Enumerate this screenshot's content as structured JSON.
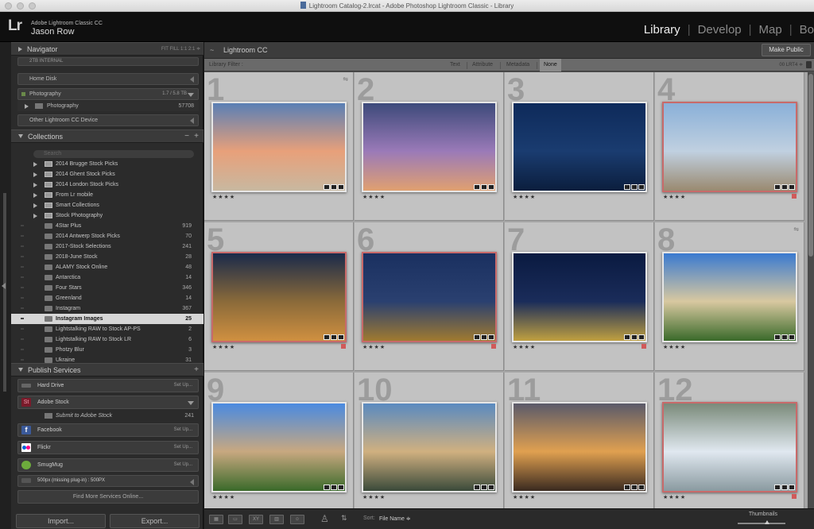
{
  "window": {
    "title": "Lightroom Catalog-2.lrcat - Adobe Photoshop Lightroom Classic - Library"
  },
  "identity": {
    "logo": "Lr",
    "product": "Adobe Lightroom Classic CC",
    "user": "Jason Row"
  },
  "modules": [
    "Library",
    "Develop",
    "Map",
    "Bo"
  ],
  "navigator": {
    "title": "Navigator",
    "modes": "FIT  FILL  1:1  2:1 ≑"
  },
  "volumes": {
    "internal": "2TB INTERNAL",
    "home": "Home Disk",
    "photography": {
      "label": "Photography",
      "capacity": "1.7 / 5.8 TB"
    },
    "photography_folder": {
      "label": "Photography",
      "count": "57708"
    },
    "other_device": "Other Lightroom CC Device"
  },
  "collections": {
    "title": "Collections",
    "search_placeholder": "Search",
    "items": [
      {
        "label": "2014 Brugge Stock Picks",
        "count": "",
        "type": "set"
      },
      {
        "label": "2014 Ghent Stock Picks",
        "count": "",
        "type": "set"
      },
      {
        "label": "2014 London Stock Picks",
        "count": "",
        "type": "set"
      },
      {
        "label": "From Lr mobile",
        "count": "",
        "type": "set"
      },
      {
        "label": "Smart Collections",
        "count": "",
        "type": "set"
      },
      {
        "label": "Stock Photography",
        "count": "",
        "type": "set"
      },
      {
        "label": "4Star Plus",
        "count": "919",
        "type": "coll"
      },
      {
        "label": "2014 Antwerp Stock Picks",
        "count": "70",
        "type": "coll"
      },
      {
        "label": "2017-Stock Selections",
        "count": "241",
        "type": "coll"
      },
      {
        "label": "2018-June Stock",
        "count": "28",
        "type": "coll"
      },
      {
        "label": "ALAMY Stock Online",
        "count": "48",
        "type": "coll"
      },
      {
        "label": "Antarctica",
        "count": "14",
        "type": "coll"
      },
      {
        "label": "Four Stars",
        "count": "346",
        "type": "coll"
      },
      {
        "label": "Greenland",
        "count": "14",
        "type": "coll"
      },
      {
        "label": "Instagram",
        "count": "367",
        "type": "coll"
      },
      {
        "label": "Instagram Images",
        "count": "25",
        "type": "coll",
        "selected": true
      },
      {
        "label": "Lightstalking RAW to Stock AP-PS",
        "count": "2",
        "type": "coll"
      },
      {
        "label": "Lightstalking RAW to Stock LR",
        "count": "6",
        "type": "coll"
      },
      {
        "label": "Photzy Blur",
        "count": "3",
        "type": "coll"
      },
      {
        "label": "Ukraine",
        "count": "31",
        "type": "coll"
      }
    ]
  },
  "publish": {
    "title": "Publish Services",
    "harddrive": {
      "label": "Hard Drive",
      "action": "Set Up..."
    },
    "adobestock": {
      "label": "Adobe Stock",
      "sub": "Submit to Adobe Stock",
      "count": "241"
    },
    "facebook": {
      "label": "Facebook",
      "action": "Set Up..."
    },
    "flickr": {
      "label": "Flickr",
      "action": "Set Up..."
    },
    "smugmug": {
      "label": "SmugMug",
      "action": "Set Up..."
    },
    "fivehundred": {
      "label": "500px (missing plug-in) : 500PX"
    },
    "findmore": "Find More Services Online..."
  },
  "buttons": {
    "import": "Import...",
    "export": "Export..."
  },
  "center": {
    "source": "Lightroom CC",
    "make_public": "Make Public",
    "filter_label": "Library Filter :",
    "filters": [
      "Text",
      "Attribute",
      "Metadata",
      "None"
    ],
    "preset": "00 LRT4 ≑"
  },
  "photos": [
    {
      "num": "1",
      "stars": "★★★★",
      "red": false,
      "label": false,
      "sky": [
        "#5a7fb5",
        "#e8a07a",
        "#c8b8a0"
      ]
    },
    {
      "num": "2",
      "stars": "★★★★",
      "red": false,
      "label": false,
      "sky": [
        "#3d4a7a",
        "#9a7ab8",
        "#e0a070"
      ]
    },
    {
      "num": "3",
      "stars": "★★★★",
      "red": false,
      "label": false,
      "sky": [
        "#0e2a5a",
        "#1a3c70",
        "#0b1e3d"
      ]
    },
    {
      "num": "4",
      "stars": "★★★★",
      "red": true,
      "label": true,
      "sky": [
        "#8ab0d8",
        "#c0d0e0",
        "#9a8a70"
      ]
    },
    {
      "num": "5",
      "stars": "★★★★",
      "red": true,
      "label": true,
      "sky": [
        "#1a2a4a",
        "#8a6a3a",
        "#d09040"
      ]
    },
    {
      "num": "6",
      "stars": "★★★★",
      "red": true,
      "label": true,
      "sky": [
        "#1a3060",
        "#2a4070",
        "#a07a30"
      ]
    },
    {
      "num": "7",
      "stars": "★★★★",
      "red": false,
      "label": true,
      "sky": [
        "#0a1a40",
        "#1a2c5a",
        "#c0a040"
      ]
    },
    {
      "num": "8",
      "stars": "★★★★",
      "red": false,
      "label": false,
      "sky": [
        "#3a7ad0",
        "#d8c8a0",
        "#3a6a2a"
      ]
    },
    {
      "num": "9",
      "stars": "★★★★",
      "red": false,
      "label": false,
      "sky": [
        "#4a8ae0",
        "#c8a880",
        "#3a6a2a"
      ]
    },
    {
      "num": "10",
      "stars": "★★★★",
      "red": false,
      "label": false,
      "sky": [
        "#5a8ac0",
        "#d0b080",
        "#3a4a3a"
      ]
    },
    {
      "num": "11",
      "stars": "★★★★",
      "red": false,
      "label": false,
      "sky": [
        "#5a5a6a",
        "#e0a050",
        "#3a2a20"
      ]
    },
    {
      "num": "12",
      "stars": "★★★★",
      "red": true,
      "label": true,
      "sky": [
        "#7a8a7a",
        "#e0e8f0",
        "#8a9aa0"
      ]
    }
  ],
  "bottom": {
    "sort_label": "Sort:",
    "sort_value": "File Name ≑",
    "thumbnails": "Thumbnails"
  }
}
